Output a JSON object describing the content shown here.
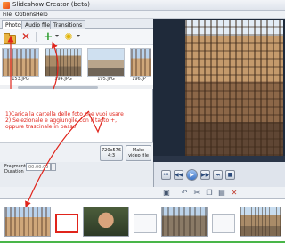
{
  "window": {
    "title": "Slideshow Creator (beta)"
  },
  "menu": {
    "file": "File",
    "options": "Options",
    "help": "Help"
  },
  "tabs": {
    "photos": "Photos",
    "audio": "Audio files",
    "transitions": "Transitions"
  },
  "thumbnails": [
    {
      "label": "153.JPG",
      "icon": "colosseum-photo"
    },
    {
      "label": "194.JPG",
      "icon": "ruins-photo"
    },
    {
      "label": "195.JPG",
      "icon": "square-photo"
    },
    {
      "label": "196.JP",
      "icon": "colosseum-photo"
    }
  ],
  "instructions": {
    "line1": "1)Carica la cartella delle foto che vuoi usare",
    "line2": "2) Selezionale e aggiungile con il tasto +,",
    "line3": "oppure trascinale in basso"
  },
  "footer": {
    "resolution_line1": "720x576",
    "resolution_line2": "4:3",
    "make_video_line1": "Make",
    "make_video_line2": "video file"
  },
  "fragment": {
    "label_line1": "Fragment",
    "label_line2": "Duration",
    "value": "00:00:05"
  },
  "colors": {
    "annotation": "#e0241b",
    "progress": "#49b649",
    "preview_bg": "#1f2a3a"
  }
}
